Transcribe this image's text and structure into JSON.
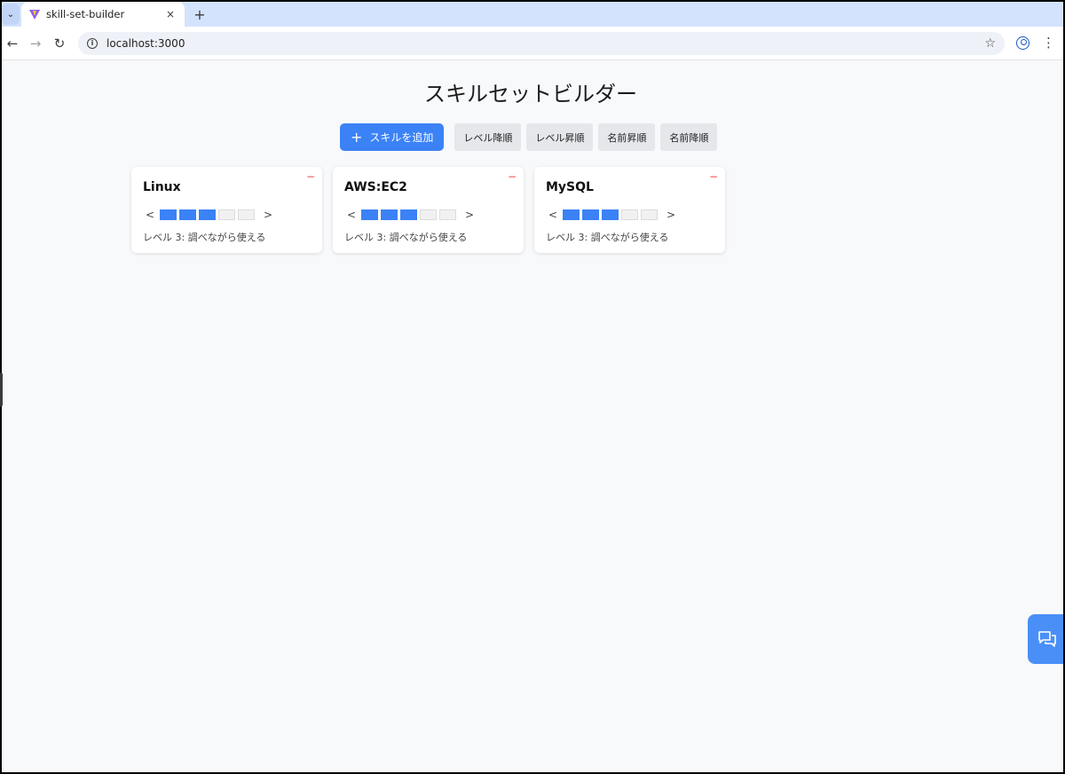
{
  "browser": {
    "tab_title": "skill-set-builder",
    "tab_close": "×",
    "new_tab": "+",
    "tab_menu": "⌄",
    "url": "localhost:3000",
    "back": "←",
    "forward": "→",
    "reload": "↻",
    "star": "☆",
    "menu": "⋮",
    "info": "i"
  },
  "page": {
    "title": "スキルセットビルダー",
    "add_button": {
      "icon": "+",
      "label": "スキルを追加"
    },
    "sort_buttons": [
      "レベル降順",
      "レベル昇順",
      "名前昇順",
      "名前降順"
    ]
  },
  "skills": [
    {
      "name": "Linux",
      "level": 3,
      "max_level": 5,
      "level_text": "レベル 3: 調べながら使える",
      "remove": "−",
      "prev": "<",
      "next": ">"
    },
    {
      "name": "AWS:EC2",
      "level": 3,
      "max_level": 5,
      "level_text": "レベル 3: 調べながら使える",
      "remove": "−",
      "prev": "<",
      "next": ">"
    },
    {
      "name": "MySQL",
      "level": 3,
      "max_level": 5,
      "level_text": "レベル 3: 調べながら使える",
      "remove": "−",
      "prev": "<",
      "next": ">"
    }
  ],
  "colors": {
    "accent": "#3b82f6",
    "remove": "#ef4444",
    "fab": "#4a8ff7"
  },
  "icons": {
    "chat_fab": "chat-bubbles-icon",
    "favicon": "vite-logo-icon"
  }
}
